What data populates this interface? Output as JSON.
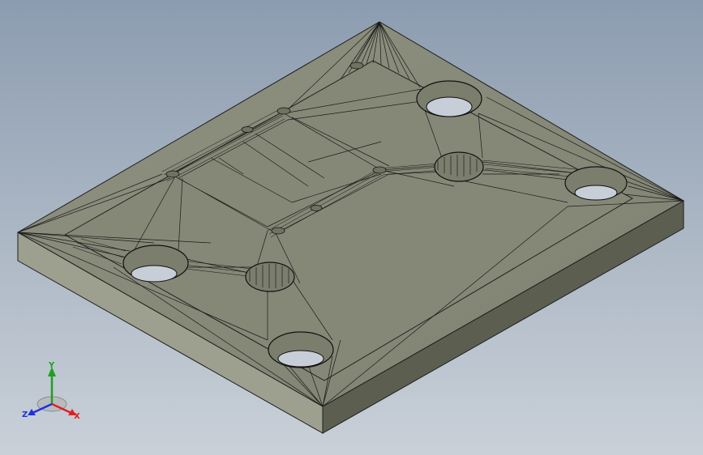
{
  "viewport": {
    "model": "plate-with-triangulated-pockets"
  },
  "triad": {
    "x_label": "X",
    "y_label": "Y",
    "z_label": "Z",
    "colors": {
      "x": "#e02020",
      "y": "#1fa01f",
      "z": "#2030e0"
    }
  }
}
